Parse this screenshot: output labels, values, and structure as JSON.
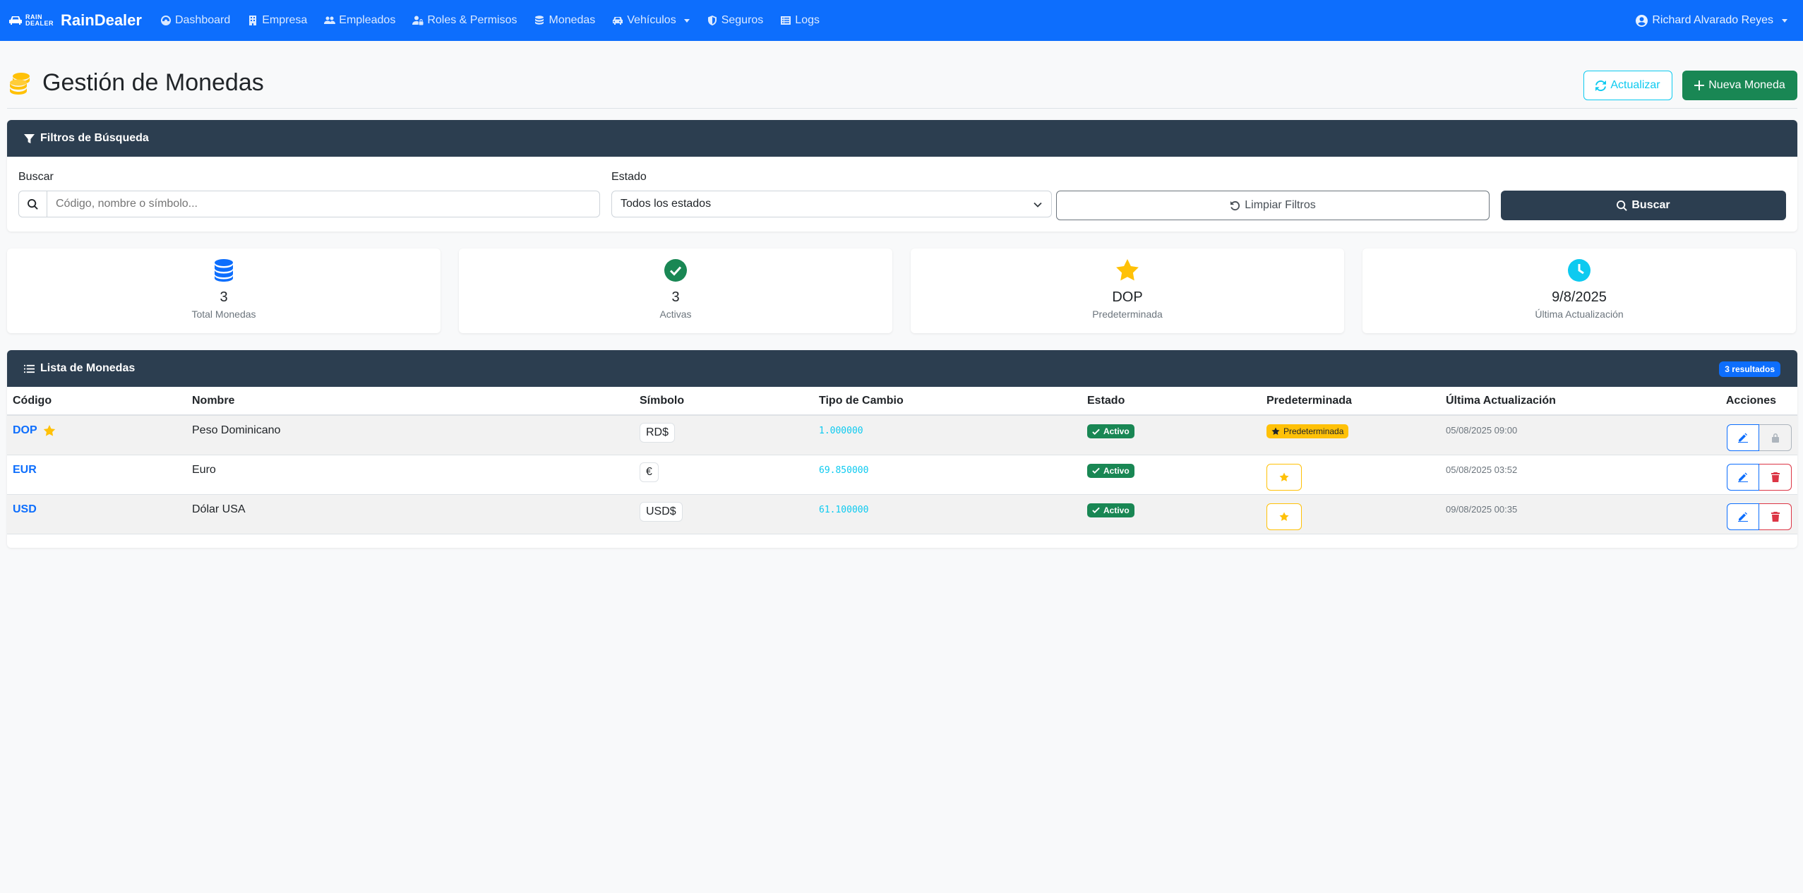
{
  "navbar": {
    "logo_line1": "RAIN",
    "logo_line2": "DEALER",
    "brand": "RainDealer",
    "items": [
      {
        "label": "Dashboard",
        "icon": "dashboard-icon"
      },
      {
        "label": "Empresa",
        "icon": "building-icon"
      },
      {
        "label": "Empleados",
        "icon": "users-icon"
      },
      {
        "label": "Roles & Permisos",
        "icon": "user-lock-icon"
      },
      {
        "label": "Monedas",
        "icon": "coins-icon"
      },
      {
        "label": "Vehículos",
        "icon": "car-icon",
        "dropdown": true
      },
      {
        "label": "Seguros",
        "icon": "shield-icon"
      },
      {
        "label": "Logs",
        "icon": "list-icon"
      }
    ],
    "user": "Richard Alvarado Reyes"
  },
  "header": {
    "title": "Gestión de Monedas",
    "refresh_label": "Actualizar",
    "new_label": "Nueva Moneda"
  },
  "filters": {
    "title": "Filtros de Búsqueda",
    "search_label": "Buscar",
    "search_placeholder": "Código, nombre o símbolo...",
    "status_label": "Estado",
    "status_value": "Todos los estados",
    "clear_label": "Limpiar Filtros",
    "search_button": "Buscar"
  },
  "stats": [
    {
      "value": "3",
      "label": "Total Monedas",
      "icon": "database-icon",
      "color": "#0d6efd"
    },
    {
      "value": "3",
      "label": "Activas",
      "icon": "check-circle-icon",
      "color": "#198754"
    },
    {
      "value": "DOP",
      "label": "Predeterminada",
      "icon": "star-icon",
      "color": "#ffc107"
    },
    {
      "value": "9/8/2025",
      "label": "Última Actualización",
      "icon": "clock-icon",
      "color": "#0dcaf0"
    }
  ],
  "list": {
    "title": "Lista de Monedas",
    "count_badge": "3 resultados",
    "columns": [
      "Código",
      "Nombre",
      "Símbolo",
      "Tipo de Cambio",
      "Estado",
      "Predeterminada",
      "Última Actualización",
      "Acciones"
    ],
    "rows": [
      {
        "code": "DOP",
        "name": "Peso Dominicano",
        "symbol": "RD$",
        "rate": "1.000000",
        "status": "Activo",
        "default": true,
        "default_label": "Predeterminada",
        "updated": "05/08/2025 09:00"
      },
      {
        "code": "EUR",
        "name": "Euro",
        "symbol": "€",
        "rate": "69.850000",
        "status": "Activo",
        "default": false,
        "updated": "05/08/2025 03:52"
      },
      {
        "code": "USD",
        "name": "Dólar USA",
        "symbol": "USD$",
        "rate": "61.100000",
        "status": "Activo",
        "default": false,
        "updated": "09/08/2025 00:35"
      }
    ]
  },
  "colors": {
    "primary": "#0d6efd",
    "dark_header": "#2c3e50",
    "success": "#198754",
    "warning": "#ffc107",
    "info": "#0dcaf0",
    "danger": "#dc3545"
  }
}
